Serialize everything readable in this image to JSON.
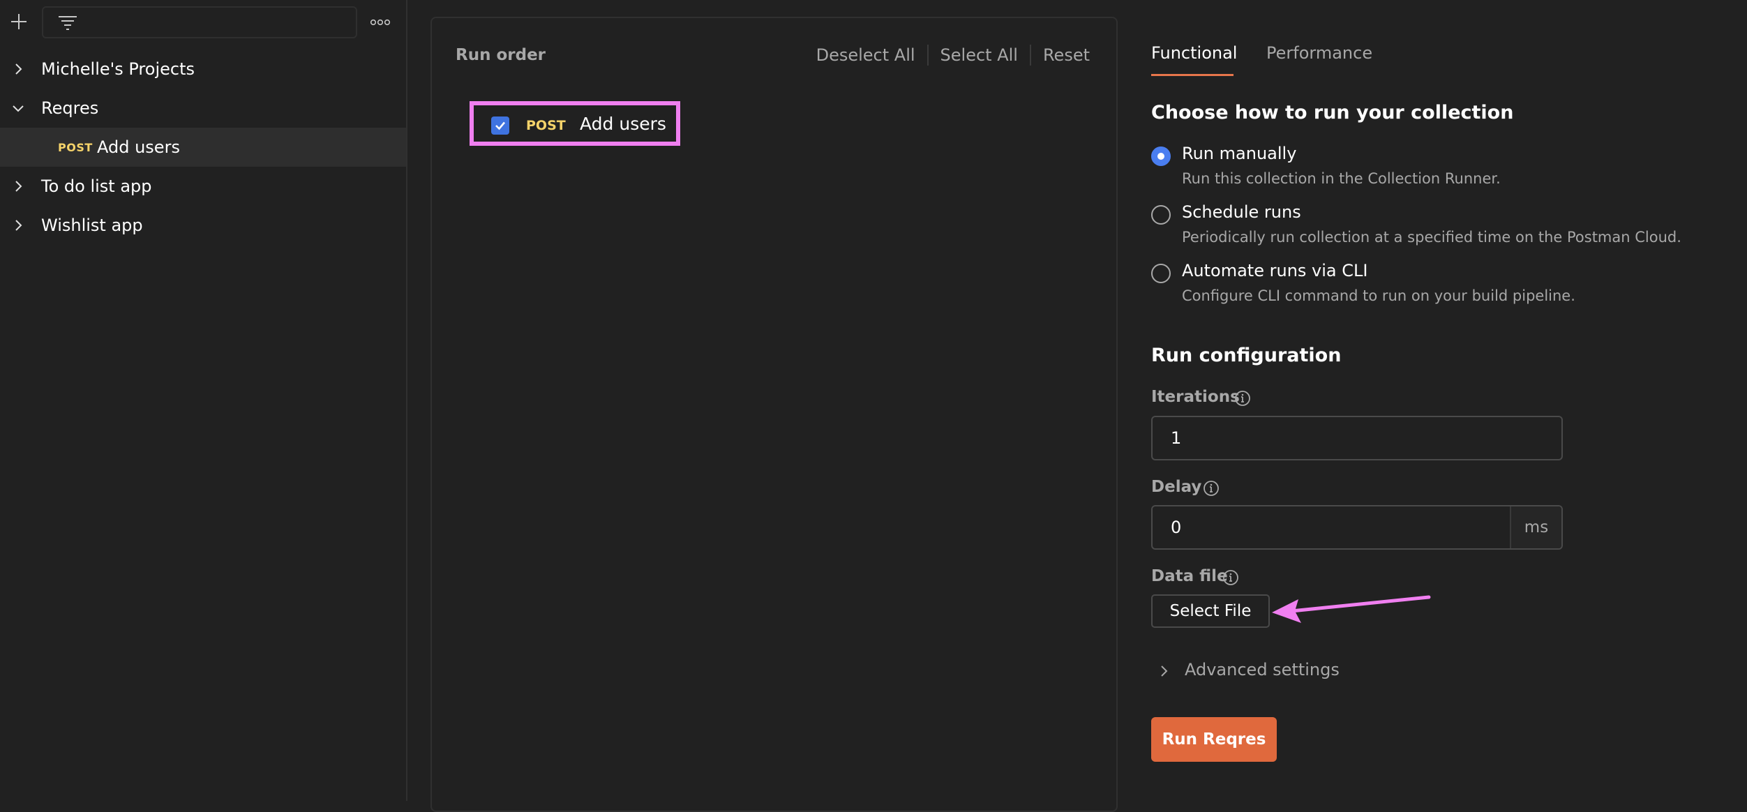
{
  "sidebar": {
    "search": {
      "placeholder": "",
      "value": ""
    },
    "items": [
      {
        "label": "Michelle's Projects",
        "expanded": false
      },
      {
        "label": "Reqres",
        "expanded": true
      },
      {
        "method": "POST",
        "label": "Add users",
        "selected": true
      },
      {
        "label": "To do list app",
        "expanded": false
      },
      {
        "label": "Wishlist app",
        "expanded": false
      }
    ]
  },
  "run_order": {
    "title": "Run order",
    "actions": {
      "deselect_all": "Deselect All",
      "select_all": "Select All",
      "reset": "Reset"
    },
    "requests": [
      {
        "checked": true,
        "method": "POST",
        "name": "Add users"
      }
    ]
  },
  "config": {
    "tabs": [
      {
        "label": "Functional",
        "active": true
      },
      {
        "label": "Performance",
        "active": false
      }
    ],
    "choose_heading": "Choose how to run your collection",
    "run_options": [
      {
        "label": "Run manually",
        "description": "Run this collection in the Collection Runner.",
        "selected": true
      },
      {
        "label": "Schedule runs",
        "description": "Periodically run collection at a specified time on the Postman Cloud.",
        "selected": false
      },
      {
        "label": "Automate runs via CLI",
        "description": "Configure CLI command to run on your build pipeline.",
        "selected": false
      }
    ],
    "run_config_heading": "Run configuration",
    "iterations": {
      "label": "Iterations",
      "value": "1"
    },
    "delay": {
      "label": "Delay",
      "value": "0",
      "unit": "ms"
    },
    "data_file": {
      "label": "Data file",
      "button": "Select File"
    },
    "advanced_settings": "Advanced settings",
    "run_button": "Run Reqres"
  },
  "colors": {
    "background": "#212121",
    "accent": "#e0693d",
    "method_post": "#f5d36a",
    "checkbox": "#3f73e0",
    "annotation": "#f07ff0"
  }
}
